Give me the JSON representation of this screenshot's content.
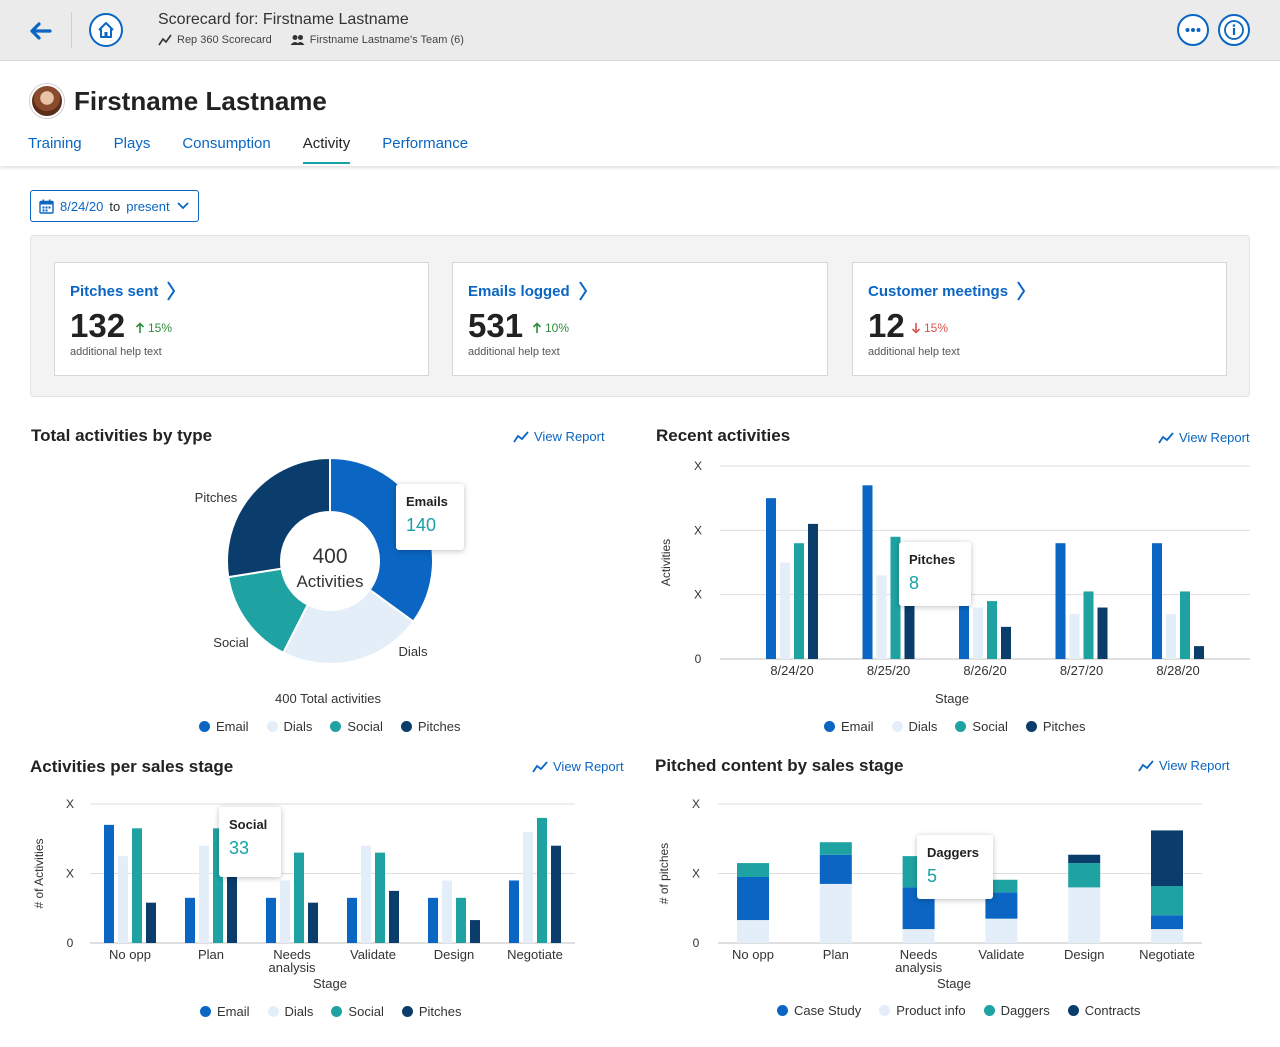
{
  "topbar": {
    "title": "Scorecard for: Firstname Lastname",
    "meta_scorecard": "Rep 360 Scorecard",
    "meta_team": "Firstname Lastname's Team (6)"
  },
  "profile": {
    "name": "Firstname Lastname"
  },
  "tabs": [
    {
      "label": "Training",
      "active": false
    },
    {
      "label": "Plays",
      "active": false
    },
    {
      "label": "Consumption",
      "active": false
    },
    {
      "label": "Activity",
      "active": true
    },
    {
      "label": "Performance",
      "active": false
    }
  ],
  "date_filter": {
    "start": "8/24/20",
    "to": "to",
    "end": "present"
  },
  "kpis": [
    {
      "label": "Pitches sent",
      "value": "132",
      "change": "15%",
      "direction": "up",
      "help": "additional help text"
    },
    {
      "label": "Emails logged",
      "value": "531",
      "change": "10%",
      "direction": "up",
      "help": "additional help text"
    },
    {
      "label": "Customer meetings",
      "value": "12",
      "change": "15%",
      "direction": "down",
      "help": "additional help text"
    }
  ],
  "colors": {
    "email": "#0a66c2",
    "dials": "#e4eef8",
    "social": "#1ea2a2",
    "pitches": "#0a3d6b",
    "up": "#2e8b3e",
    "down": "#d9534f"
  },
  "sections": {
    "total": {
      "title": "Total activities by type",
      "view_report": "View Report"
    },
    "recent": {
      "title": "Recent activities",
      "view_report": "View Report"
    },
    "per_stage": {
      "title": "Activities per sales stage",
      "view_report": "View Report"
    },
    "pitched": {
      "title": "Pitched content by sales stage",
      "view_report": "View Report"
    }
  },
  "chart_data": [
    {
      "type": "pie",
      "title": "Total activities by type",
      "center_value": "400",
      "center_label": "Activities",
      "caption": "400 Total activities",
      "slices": [
        {
          "name": "Emails",
          "value": 140,
          "label": "Emails",
          "color": "#0a66c2"
        },
        {
          "name": "Dials",
          "value": 90,
          "label": "Dials",
          "color": "#e4eef8"
        },
        {
          "name": "Social",
          "value": 60,
          "label": "Social",
          "color": "#1ea2a2"
        },
        {
          "name": "Pitches",
          "value": 110,
          "label": "Pitches",
          "color": "#0a3d6b"
        }
      ],
      "legend": [
        "Email",
        "Dials",
        "Social",
        "Pitches"
      ],
      "tooltip": {
        "label": "Emails",
        "value": "140"
      }
    },
    {
      "type": "bar",
      "title": "Recent activities",
      "xlabel": "Stage",
      "ylabel": "Activities",
      "y_tick_labels": [
        "0",
        "X",
        "X",
        "X"
      ],
      "categories": [
        "8/24/20",
        "8/25/20",
        "8/26/20",
        "8/27/20",
        "8/28/20"
      ],
      "ylim": [
        0,
        3
      ],
      "series": [
        {
          "name": "Email",
          "color": "#0a66c2",
          "values": [
            2.5,
            2.7,
            1.8,
            1.8,
            1.8
          ]
        },
        {
          "name": "Dials",
          "color": "#e4eef8",
          "values": [
            1.5,
            1.3,
            0.8,
            0.7,
            0.7
          ]
        },
        {
          "name": "Social",
          "color": "#1ea2a2",
          "values": [
            1.8,
            1.9,
            0.9,
            1.05,
            1.05
          ]
        },
        {
          "name": "Pitches",
          "color": "#0a3d6b",
          "values": [
            2.1,
            1.6,
            0.5,
            0.8,
            0.2
          ]
        }
      ],
      "legend": [
        "Email",
        "Dials",
        "Social",
        "Pitches"
      ],
      "tooltip": {
        "label": "Pitches",
        "value": "8"
      }
    },
    {
      "type": "bar",
      "title": "Activities per sales stage",
      "xlabel": "Stage",
      "ylabel": "# of Activities",
      "y_tick_labels": [
        "0",
        "X",
        "X"
      ],
      "categories": [
        "No opp",
        "Plan",
        "Needs\nanalysis",
        "Validate",
        "Design",
        "Negotiate"
      ],
      "ylim": [
        0,
        2
      ],
      "series": [
        {
          "name": "Email",
          "color": "#0a66c2",
          "values": [
            1.7,
            0.65,
            0.65,
            0.65,
            0.65,
            0.9
          ]
        },
        {
          "name": "Dials",
          "color": "#e4eef8",
          "values": [
            1.25,
            1.4,
            0.9,
            1.4,
            0.9,
            1.6
          ]
        },
        {
          "name": "Social",
          "color": "#1ea2a2",
          "values": [
            1.65,
            1.65,
            1.3,
            1.3,
            0.65,
            1.8
          ]
        },
        {
          "name": "Pitches",
          "color": "#0a3d6b",
          "values": [
            0.58,
            0.95,
            0.58,
            0.75,
            0.33,
            1.4
          ]
        }
      ],
      "legend": [
        "Email",
        "Dials",
        "Social",
        "Pitches"
      ],
      "tooltip": {
        "label": "Social",
        "value": "33"
      }
    },
    {
      "type": "bar",
      "stacked": true,
      "title": "Pitched content by sales stage",
      "xlabel": "Stage",
      "ylabel": "# of pitches",
      "y_tick_labels": [
        "0",
        "X",
        "X"
      ],
      "categories": [
        "No opp",
        "Plan",
        "Needs\nanalysis",
        "Validate",
        "Design",
        "Negotiate"
      ],
      "ylim": [
        0,
        2
      ],
      "series": [
        {
          "name": "Product info",
          "color": "#e4eef8",
          "values": [
            0.33,
            0.85,
            0.2,
            0.35,
            0.8,
            0.2
          ]
        },
        {
          "name": "Case Study",
          "color": "#0a66c2",
          "values": [
            0.62,
            0.42,
            0.6,
            0.38,
            0.0,
            0.2
          ]
        },
        {
          "name": "Daggers",
          "color": "#1ea2a2",
          "values": [
            0.2,
            0.18,
            0.45,
            0.18,
            0.35,
            0.42
          ]
        },
        {
          "name": "Contracts",
          "color": "#0a3d6b",
          "values": [
            0.0,
            0.0,
            0.0,
            0.0,
            0.12,
            0.8
          ]
        }
      ],
      "legend": [
        "Case Study",
        "Product info",
        "Daggers",
        "Contracts"
      ],
      "tooltip": {
        "label": "Daggers",
        "value": "5"
      }
    }
  ]
}
